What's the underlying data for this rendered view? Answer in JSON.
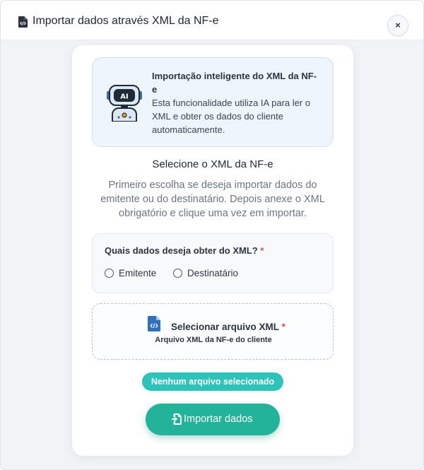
{
  "header": {
    "title": "Importar dados através XML da NF-e",
    "close_label": "×"
  },
  "ai_info": {
    "title": "Importação inteligente do XML da NF-e",
    "description": "Esta funcionalidade utiliza IA para ler o XML e obter os dados do cliente automaticamente.",
    "robot_badge": "AI"
  },
  "section": {
    "title": "Selecione o XML da NF-e",
    "description": "Primeiro escolha se deseja importar dados do emitente ou do destinatário. Depois anexe o XML obrigatório e clique uma vez em importar."
  },
  "question": {
    "label": "Quais dados deseja obter do XML?",
    "required_mark": "*",
    "options": [
      {
        "label": "Emitente",
        "selected": false
      },
      {
        "label": "Destinatário",
        "selected": false
      }
    ]
  },
  "upload": {
    "label": "Selecionar arquivo XML",
    "required_mark": "*",
    "sublabel": "Arquivo XML da NF-e do cliente",
    "icon": "xml-file-icon"
  },
  "file_status": "Nenhum arquivo selecionado",
  "import_button": {
    "label": "Importar dados",
    "icon": "import-icon"
  },
  "colors": {
    "accent": "#22b39a",
    "badge": "#2cc4ba",
    "required": "#e24a4a",
    "info_bg": "#eef5fd",
    "file_icon": "#2f6fc0"
  }
}
